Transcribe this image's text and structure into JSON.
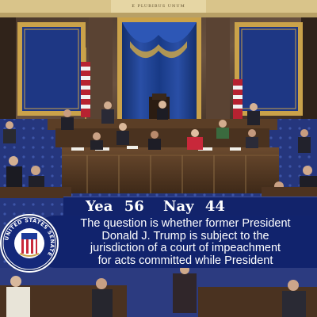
{
  "scene": {
    "inscription": "E PLURIBUS UNUM",
    "colors": {
      "caption_background": "#11236d",
      "vote_bar_background": "#12236b",
      "caption_text": "#ffffff",
      "drape": "#1e3c91",
      "carpet": "#2a3f8f"
    }
  },
  "vote": {
    "yea_label": "Yea",
    "yea_count": "56",
    "nay_label": "Nay",
    "nay_count": "44"
  },
  "caption": {
    "lines": [
      "The question is whether former President",
      "Donald J. Trump is subject to the",
      "jurisdiction of a court of impeachment",
      "for acts committed while President"
    ]
  },
  "seal": {
    "text": "UNITED STATES SENATE",
    "icon": "senate-seal-icon"
  }
}
